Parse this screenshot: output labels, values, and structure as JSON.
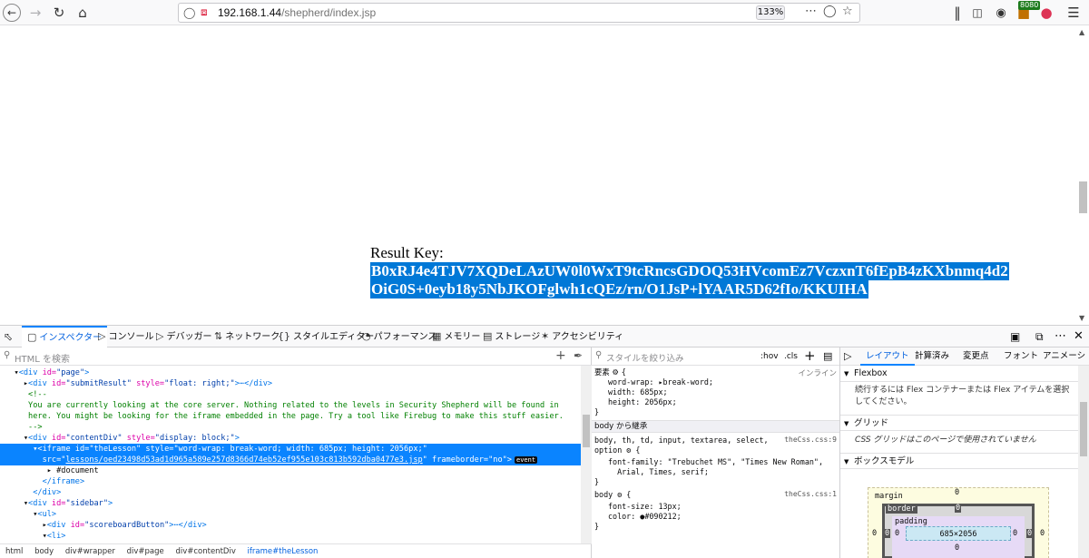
{
  "browser": {
    "url_host": "192.168.1.44",
    "url_path": "/shepherd/index.jsp",
    "zoom": "133%",
    "proxy_badge": "8080"
  },
  "page": {
    "result_label": "Result Key:",
    "key_line1": "B0xRJ4e4TJV7XQDeLAzUW0l0WxT9tcRncsGDOQ53HVcomEz7VczxnT6fEpB4zKXbnmq4d2",
    "key_line2": "OiG0S+0eyb18y5NbJKOFglwh1cQEz/rn/O1JsP+lYAAR5D62fIo/KKUIHA"
  },
  "devtools": {
    "tabs": [
      {
        "label": "インスペクター",
        "icon": "inspector-icon"
      },
      {
        "label": "コンソール",
        "icon": "console-icon"
      },
      {
        "label": "デバッガー",
        "icon": "debugger-icon"
      },
      {
        "label": "ネットワーク",
        "icon": "network-icon"
      },
      {
        "label": "スタイルエディター",
        "icon": "style-editor-icon"
      },
      {
        "label": "パフォーマンス",
        "icon": "performance-icon"
      },
      {
        "label": "メモリー",
        "icon": "memory-icon"
      },
      {
        "label": "ストレージ",
        "icon": "storage-icon"
      },
      {
        "label": "アクセシビリティ",
        "icon": "accessibility-icon"
      }
    ],
    "markup_search_placeholder": "HTML を検索",
    "markup": {
      "l1_tag": "<div ",
      "l1_attr": "id=",
      "l1_val": "\"page\"",
      "l1_end": ">",
      "l2_tag": "<div ",
      "l2_attr": "id=",
      "l2_val": "\"submitResult\"",
      "l2_attr2": " style=",
      "l2_val2": "\"float: right;\"",
      "l2_end": ">⋯</div>",
      "l3": "<!--",
      "l4": "  You are currently looking at the core server. Nothing related to the levels in Security Shepherd will be found in",
      "l5": "  here. You might be looking for the iframe embedded in the page. Try a tool like Firebug to make this stuff easier.",
      "l6": "-->",
      "l7_tag": "<div ",
      "l7_attr": "id=",
      "l7_val": "\"contentDiv\"",
      "l7_attr2": " style=",
      "l7_val2": "\"display: block;\"",
      "l7_end": ">",
      "l8": "<iframe id=\"theLesson\" style=\"word-wrap: break-word; width: 685px; height: 2056px;\"",
      "l9a": "src=\"",
      "l9b": "lessons/oed23498d53ad1d965a589e257d8366d74eb52ef955e103c813b592dba0477e3.jsp",
      "l9c": "\" frameborder=\"no\">",
      "event_badge": "event",
      "l10": "#document",
      "l11": "</iframe>",
      "l12": "</div>",
      "l13_tag": "<div ",
      "l13_attr": "id=",
      "l13_val": "\"sidebar\"",
      "l13_end": ">",
      "l14": "<ul>",
      "l15_tag": "<div ",
      "l15_attr": "id=",
      "l15_val": "\"scoreboardButton\"",
      "l15_end": ">⋯</div>",
      "l16": "<li>"
    },
    "breadcrumbs": [
      "html",
      "body",
      "div#wrapper",
      "div#page",
      "div#contentDiv",
      "iframe#theLesson"
    ],
    "rules": {
      "filter_placeholder": "スタイルを絞り込み",
      "hov": ":hov",
      "cls": ".cls",
      "element_label": "要素 ⚙ {",
      "inline_label": "インライン",
      "r1": "word-wrap: ▸break-word;",
      "r2": "width: 685px;",
      "r3": "height: 2056px;",
      "inherited_header": "body から継承",
      "sel1": "body, th, td, input, textarea, select,",
      "sel1b": "option ⚙ {",
      "src1": "theCss.css:9",
      "ff1": "font-family: \"Trebuchet MS\", \"Times New Roman\",",
      "ff2": "  Arial, Times, serif;",
      "sel2": "body ⚙ {",
      "src2": "theCss.css:1",
      "fs": "font-size: 13px;",
      "col": "color: ●#090212;",
      "close": "}"
    },
    "layout": {
      "tabs": [
        "レイアウト",
        "計算済み",
        "変更点",
        "フォント",
        "アニメーシ"
      ],
      "flexbox": "Flexbox",
      "flex_msg": "続行するには Flex コンテナーまたは Flex アイテムを選択してください。",
      "grid": "グリッド",
      "grid_msg": "CSS グリッドはこのページで使用されていません",
      "boxmodel": "ボックスモデル",
      "margin": "margin",
      "border": "border",
      "padding": "padding",
      "zero": "0",
      "content_size": "685×2056"
    }
  }
}
